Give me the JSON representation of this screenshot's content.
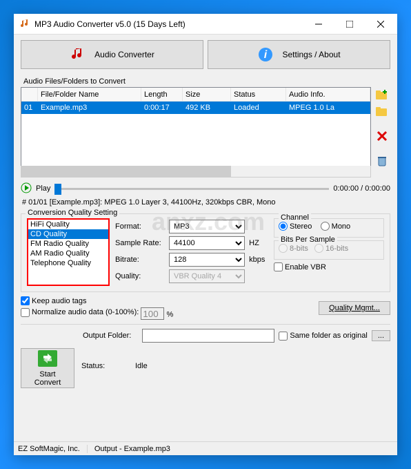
{
  "window": {
    "title": "MP3 Audio Converter v5.0 (15 Days Left)"
  },
  "toprow": {
    "audio_converter": "Audio Converter",
    "settings_about": "Settings / About"
  },
  "files": {
    "label": "Audio Files/Folders to Convert",
    "headers": {
      "num": "",
      "name": "File/Folder Name",
      "length": "Length",
      "size": "Size",
      "status": "Status",
      "info": "Audio Info."
    },
    "row": {
      "num": "01",
      "name": "Example.mp3",
      "length": "0:00:17",
      "size": "492 KB",
      "status": "Loaded",
      "info": "MPEG 1.0 La"
    }
  },
  "player": {
    "play": "Play",
    "time": "0:00:00 / 0:00:00",
    "info": "# 01/01 [Example.mp3]: MPEG 1.0 Layer 3, 44100Hz, 320kbps CBR, Mono"
  },
  "quality": {
    "legend": "Conversion Quality Setting",
    "list": [
      "HiFi Quality",
      "CD Quality",
      "FM Radio Quality",
      "AM Radio Quality",
      "Telephone Quality"
    ],
    "selected_index": 1,
    "format_lbl": "Format:",
    "format": "MP3",
    "sr_lbl": "Sample Rate:",
    "sr": "44100",
    "sr_unit": "HZ",
    "br_lbl": "Bitrate:",
    "br": "128",
    "br_unit": "kbps",
    "q_lbl": "Quality:",
    "q": "VBR Quality 4",
    "channel_lbl": "Channel",
    "stereo": "Stereo",
    "mono": "Mono",
    "bits_lbl": "Bits Per Sample",
    "bits8": "8-bits",
    "bits16": "16-bits",
    "vbr": "Enable VBR",
    "keep_tags": "Keep audio tags",
    "normalize": "Normalize audio data (0-100%):",
    "normalize_val": "100",
    "pct": "%",
    "qmgmt": "Quality Mgmt..."
  },
  "output": {
    "folder_lbl": "Output Folder:",
    "folder": "",
    "same": "Same folder as original",
    "browse": "...",
    "status_lbl": "Status:",
    "status": "Idle",
    "start": "Start Convert"
  },
  "statusbar": {
    "company": "EZ SoftMagic, Inc.",
    "output": "Output - Example.mp3"
  },
  "watermark": "anxz.com"
}
